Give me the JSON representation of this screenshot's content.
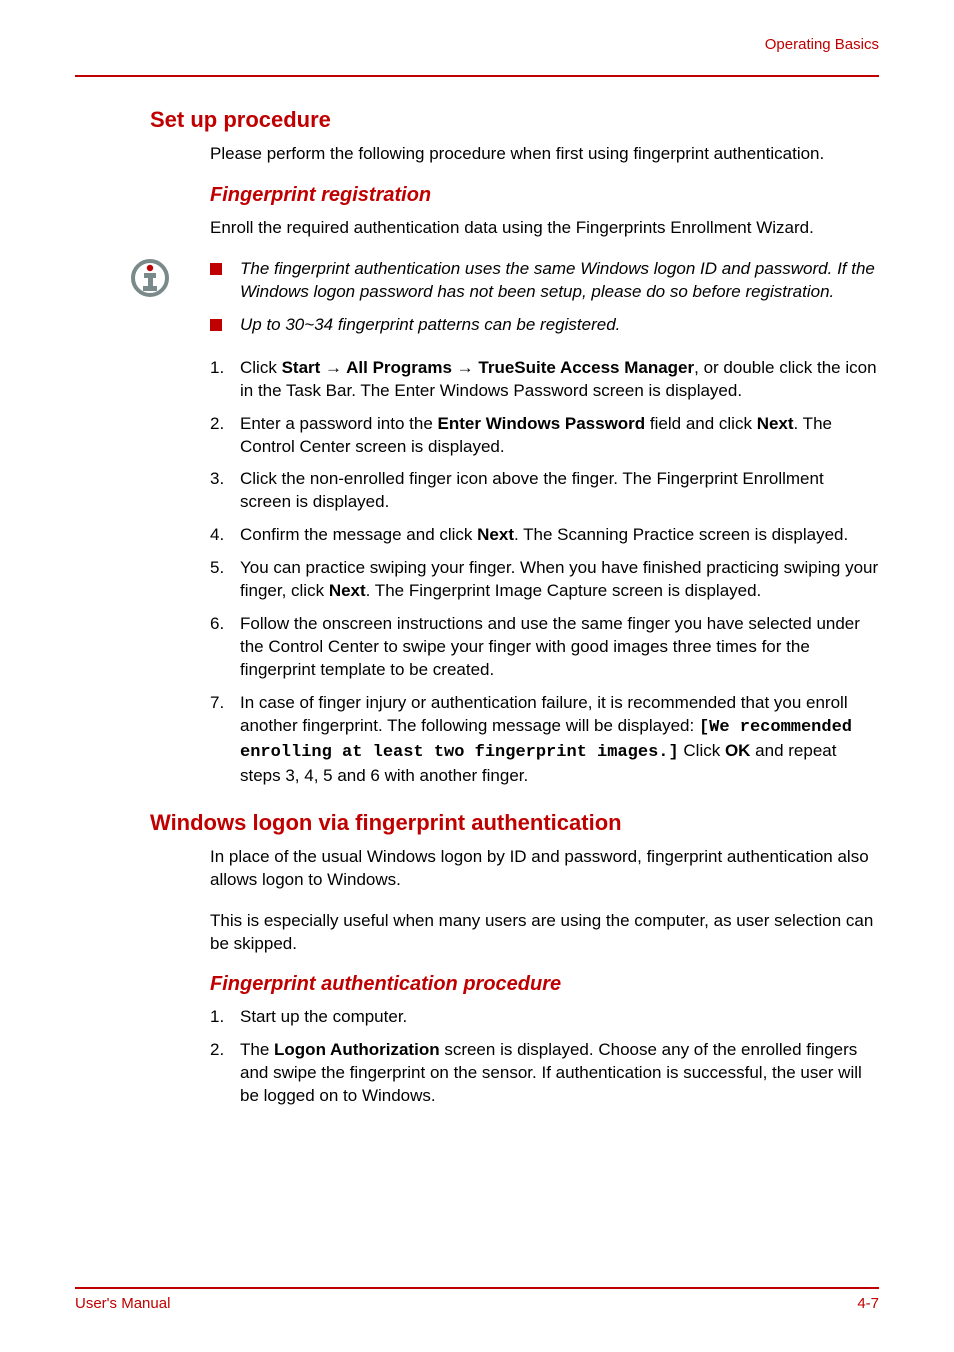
{
  "header": {
    "section": "Operating Basics"
  },
  "footer": {
    "left": "User's Manual",
    "right": "4-7"
  },
  "s1": {
    "title": "Set up procedure",
    "intro": "Please perform the following procedure when first using fingerprint authentication."
  },
  "s1a": {
    "title": "Fingerprint registration",
    "intro": "Enroll the required authentication data using the Fingerprints Enrollment Wizard.",
    "notes": [
      "The fingerprint authentication uses the same Windows logon ID and password. If the Windows logon password has not been setup, please do so before registration.",
      "Up to 30~34 fingerprint patterns can be registered."
    ],
    "step1": {
      "a": "Click ",
      "b1": "Start",
      "arr": " → ",
      "b2": "All Programs",
      "b3": "TrueSuite Access Manager",
      "c": ", or double click the icon in the Task Bar. The Enter Windows Password screen is displayed."
    },
    "step2": {
      "a": "Enter a password into the ",
      "b1": "Enter Windows Password",
      "c": " field and click ",
      "b2": "Next",
      "d": ". The Control Center screen is displayed."
    },
    "step3": "Click the non-enrolled finger icon above the finger. The Fingerprint Enrollment screen is displayed.",
    "step4": {
      "a": "Confirm the message and click ",
      "b1": "Next",
      "c": ". The Scanning Practice screen is displayed."
    },
    "step5": {
      "a": "You can practice swiping your finger. When you have finished practicing swiping your finger, click ",
      "b1": "Next",
      "c": ". The Fingerprint Image Capture screen is displayed."
    },
    "step6": "Follow the onscreen instructions and use the same finger you have selected under the Control Center to swipe your finger with good images three times for the fingerprint template to be created.",
    "step7": {
      "a": "In case of finger injury or authentication failure, it is recommended that you enroll another fingerprint. The following message will be displayed: ",
      "mono": "[We recommended enrolling at least two fingerprint images.]",
      "c": " Click ",
      "b1": "OK",
      "d": " and repeat steps 3, 4, 5 and 6 with another finger."
    }
  },
  "s2": {
    "title": "Windows logon via fingerprint authentication",
    "p1": "In place of the usual Windows logon by ID and password, fingerprint authentication also allows logon to Windows.",
    "p2": "This is especially useful when many users are using the computer, as user selection can be skipped."
  },
  "s2a": {
    "title": "Fingerprint authentication procedure",
    "step1": "Start up the computer.",
    "step2": {
      "a": "The ",
      "b1": "Logon Authorization",
      "c": " screen is displayed. Choose any of the enrolled fingers and swipe the fingerprint on the sensor. If authentication is successful, the user will be logged on to Windows."
    }
  }
}
